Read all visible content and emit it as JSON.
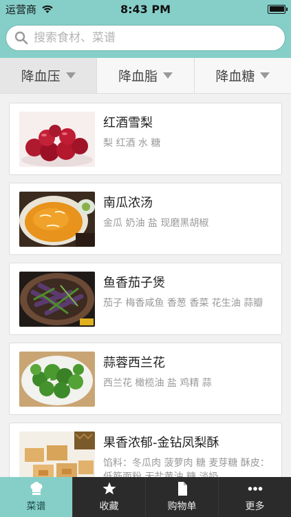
{
  "status_bar": {
    "carrier": "运营商",
    "time": "8:43 PM"
  },
  "search": {
    "placeholder": "搜索食材、菜谱",
    "value": ""
  },
  "filters": [
    {
      "label": "降血压"
    },
    {
      "label": "降血脂"
    },
    {
      "label": "降血糖"
    }
  ],
  "recipes": [
    {
      "title": "红酒雪梨",
      "ingredients": "梨 红酒 水 糖",
      "thumb_icon": "red-wine-pear-photo"
    },
    {
      "title": "南瓜浓汤",
      "ingredients": "金瓜 奶油 盐 现磨黑胡椒",
      "thumb_icon": "pumpkin-soup-photo"
    },
    {
      "title": "鱼香茄子煲",
      "ingredients": "茄子 梅香咸鱼 香葱 香菜 花生油 蒜瓣",
      "thumb_icon": "eggplant-pot-photo"
    },
    {
      "title": "蒜蓉西兰花",
      "ingredients": "西兰花 橄榄油 盐 鸡精 蒜",
      "thumb_icon": "broccoli-photo"
    },
    {
      "title": "果香浓郁-金钻凤梨酥",
      "ingredients": "馅料：冬瓜肉 菠萝肉 糖 麦芽糖 酥皮：低筋面粉 无盐黄油 糖 淡奶",
      "thumb_icon": "pineapple-cake-photo"
    }
  ],
  "tabs": [
    {
      "label": "菜谱",
      "icon": "chef-hat-icon"
    },
    {
      "label": "收藏",
      "icon": "star-icon"
    },
    {
      "label": "购物单",
      "icon": "document-icon"
    },
    {
      "label": "更多",
      "icon": "more-dots-icon"
    }
  ],
  "colors": {
    "accent": "#86cfc9",
    "tab_bar": "#2b2b2b"
  }
}
